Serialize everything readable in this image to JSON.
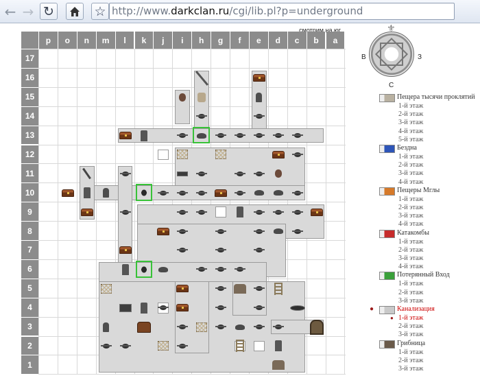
{
  "browser": {
    "url_prefix": "http://www.",
    "url_host": "darkclan.ru",
    "url_path": "/cgi/lib.pl?p=underground",
    "back_icon": "arrow-left-icon",
    "forward_icon": "arrow-right-icon",
    "reload_icon": "reload-icon",
    "home_icon": "home-icon",
    "bookmark_icon": "star-icon"
  },
  "map": {
    "view_label": "смотрим на юг",
    "columns": [
      "p",
      "o",
      "n",
      "m",
      "l",
      "k",
      "j",
      "i",
      "h",
      "g",
      "f",
      "e",
      "d",
      "c",
      "b",
      "a"
    ],
    "rows": [
      "17",
      "16",
      "15",
      "14",
      "13",
      "12",
      "11",
      "10",
      "9",
      "8",
      "7",
      "6",
      "5",
      "4",
      "3",
      "2",
      "1"
    ],
    "colors": {
      "header": "#8c8c8c",
      "room": "#c8c8c8",
      "highlight": "#37c237"
    }
  },
  "compass": {
    "north": "С",
    "east": "З",
    "west": "В"
  },
  "locations": [
    {
      "name": "Пещера тысячи проклятий",
      "icon": "cave-icon",
      "floors": [
        "1-й этаж",
        "2-й этаж",
        "3-й этаж",
        "4-й этаж",
        "5-й этаж"
      ]
    },
    {
      "name": "Бездна",
      "icon": "abyss-icon",
      "floors": [
        "1-й этаж",
        "2-й этаж",
        "3-й этаж",
        "4-й этаж"
      ]
    },
    {
      "name": "Пещеры Мглы",
      "icon": "mist-caves-icon",
      "floors": [
        "1-й этаж",
        "2-й этаж",
        "3-й этаж",
        "4-й этаж"
      ]
    },
    {
      "name": "Катакомбы",
      "icon": "catacombs-icon",
      "floors": [
        "1-й этаж",
        "2-й этаж",
        "3-й этаж",
        "4-й этаж"
      ]
    },
    {
      "name": "Потерянный Вход",
      "icon": "lost-entrance-icon",
      "floors": [
        "1-й этаж",
        "2-й этаж",
        "3-й этаж"
      ]
    },
    {
      "name": "Канализация",
      "icon": "sewer-icon",
      "active": true,
      "floors": [
        "1-й этаж",
        "2-й этаж",
        "3-й этаж"
      ],
      "active_floor": 0
    },
    {
      "name": "Грибница",
      "icon": "mushroom-icon",
      "floors": [
        "1-й этаж",
        "2-й этаж",
        "3-й этаж"
      ]
    }
  ]
}
